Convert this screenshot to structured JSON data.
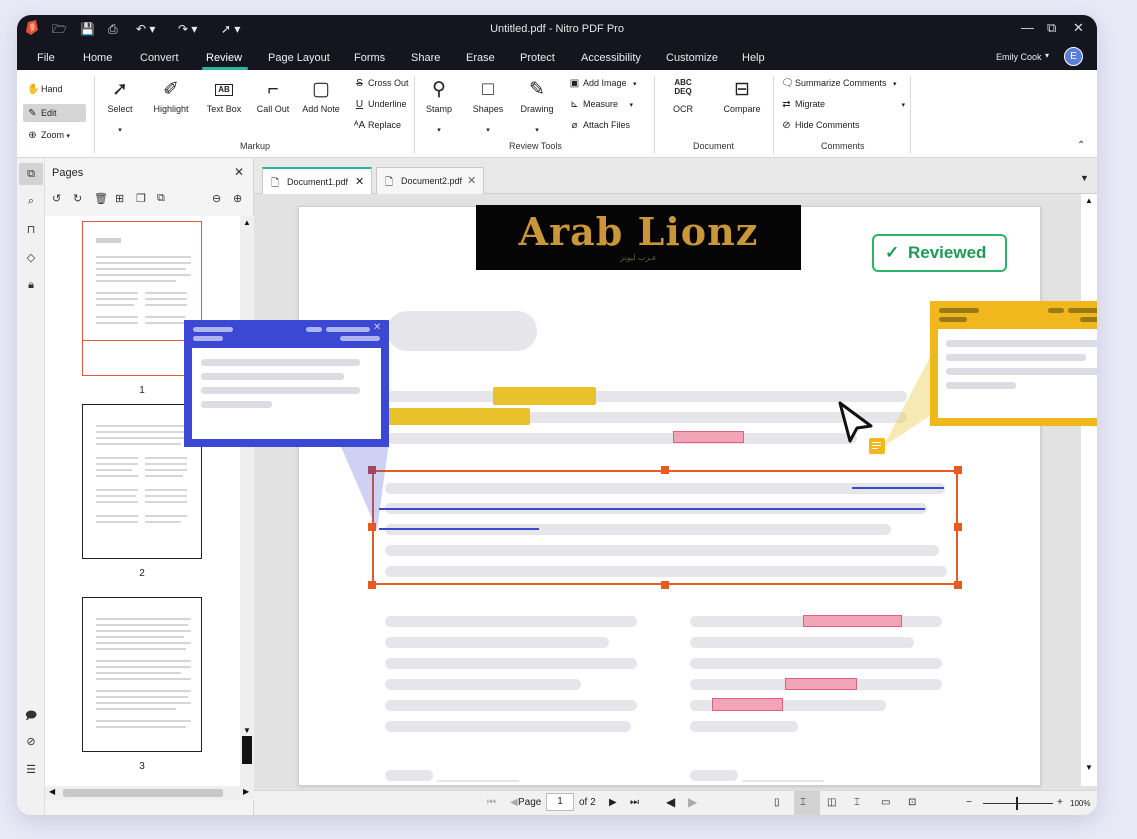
{
  "window": {
    "title": "Untitled.pdf - Nitro PDF Pro"
  },
  "menu": {
    "items": [
      "File",
      "Home",
      "Convert",
      "Review",
      "Page Layout",
      "Forms",
      "Share",
      "Erase",
      "Protect",
      "Accessibility",
      "Customize",
      "Help"
    ],
    "active": "Review"
  },
  "user": {
    "name": "Emily Cook",
    "initial": "E"
  },
  "ribbon": {
    "hand": "Hand",
    "edit": "Edit",
    "zoom": "Zoom",
    "select": "Select",
    "highlight": "Highlight",
    "text_box": "Text Box",
    "call_out": "Call Out",
    "add_note": "Add Note",
    "cross_out": "Cross Out",
    "underline": "Underline",
    "replace": "Replace",
    "stamp": "Stamp",
    "shapes": "Shapes",
    "drawing": "Drawing",
    "add_image": "Add Image",
    "measure": "Measure",
    "attach_files": "Attach Files",
    "ocr": "OCR",
    "compare": "Compare",
    "summarize_comments": "Summarize Comments",
    "migrate": "Migrate",
    "hide_comments": "Hide Comments",
    "groups": {
      "markup": "Markup",
      "review_tools": "Review Tools",
      "document": "Document",
      "comments": "Comments"
    }
  },
  "pages_panel": {
    "title": "Pages",
    "pages": [
      "1",
      "2",
      "3"
    ]
  },
  "tabs": [
    {
      "label": "Document1.pdf",
      "active": true
    },
    {
      "label": "Document2.pdf",
      "active": false
    }
  ],
  "document": {
    "logo_text": "Arab Lionz",
    "logo_subtext": "ﻋـﺮﺏ ﻟﻴﻮﻧﺰ",
    "stamp_text": "Reviewed",
    "stamp_color": "#2fb36b"
  },
  "status": {
    "page_label": "Page",
    "current_page": "1",
    "of_label": "of 2",
    "zoom": "100%"
  },
  "colors": {
    "accent": "#2bb5a0",
    "selection": "#e85a20",
    "blue_comment": "#3b48d4",
    "yellow_comment": "#f0b81c",
    "highlight_yellow": "#e9c12a",
    "highlight_pink": "#f1a5b6"
  }
}
